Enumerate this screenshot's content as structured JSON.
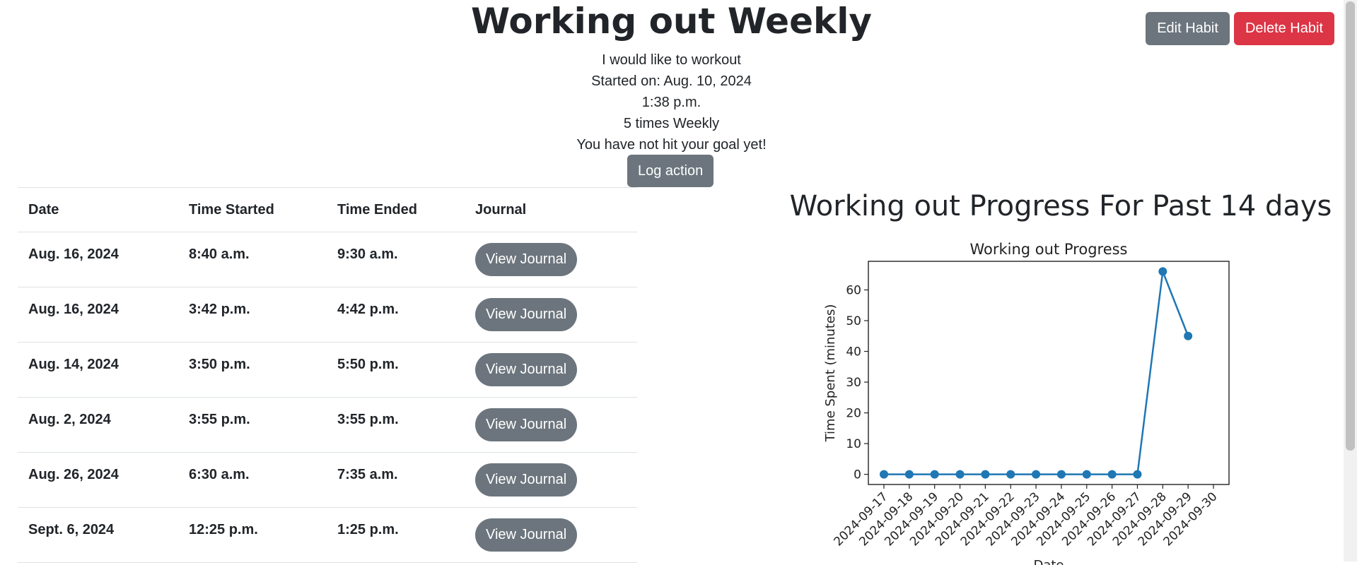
{
  "header": {
    "title": "Working out Weekly",
    "edit_label": "Edit Habit",
    "delete_label": "Delete Habit"
  },
  "habit": {
    "description": "I would like to workout",
    "started_on": "Started on: Aug. 10, 2024",
    "start_time": "1:38 p.m.",
    "frequency": "5 times Weekly",
    "goal_status": "You have not hit your goal yet!",
    "log_label": "Log action"
  },
  "table": {
    "headers": [
      "Date",
      "Time Started",
      "Time Ended",
      "Journal"
    ],
    "rows": [
      {
        "date": "Aug. 16, 2024",
        "start": "8:40 a.m.",
        "end": "9:30 a.m.",
        "journal": "View Journal"
      },
      {
        "date": "Aug. 16, 2024",
        "start": "3:42 p.m.",
        "end": "4:42 p.m.",
        "journal": "View Journal"
      },
      {
        "date": "Aug. 14, 2024",
        "start": "3:50 p.m.",
        "end": "5:50 p.m.",
        "journal": "View Journal"
      },
      {
        "date": "Aug. 2, 2024",
        "start": "3:55 p.m.",
        "end": "3:55 p.m.",
        "journal": "View Journal"
      },
      {
        "date": "Aug. 26, 2024",
        "start": "6:30 a.m.",
        "end": "7:35 a.m.",
        "journal": "View Journal"
      },
      {
        "date": "Sept. 6, 2024",
        "start": "12:25 p.m.",
        "end": "1:25 p.m.",
        "journal": "View Journal"
      }
    ]
  },
  "progress": {
    "heading": "Working out Progress For Past 14 days"
  },
  "colors": {
    "secondary": "#6c757d",
    "danger": "#dc3545",
    "series": "#1f77b4"
  },
  "chart_data": {
    "type": "line",
    "title": "Working out Progress",
    "xlabel": "Date",
    "ylabel": "Time Spent (minutes)",
    "x": [
      "2024-09-17",
      "2024-09-18",
      "2024-09-19",
      "2024-09-20",
      "2024-09-21",
      "2024-09-22",
      "2024-09-23",
      "2024-09-24",
      "2024-09-25",
      "2024-09-26",
      "2024-09-27",
      "2024-09-28",
      "2024-09-29",
      "2024-09-30"
    ],
    "values": [
      0,
      0,
      0,
      0,
      0,
      0,
      0,
      0,
      0,
      0,
      0,
      66,
      45
    ],
    "yticks": [
      0,
      10,
      20,
      30,
      40,
      50,
      60
    ],
    "ylim": [
      -3.3,
      69.3
    ],
    "grid": false,
    "marker": "circle"
  }
}
